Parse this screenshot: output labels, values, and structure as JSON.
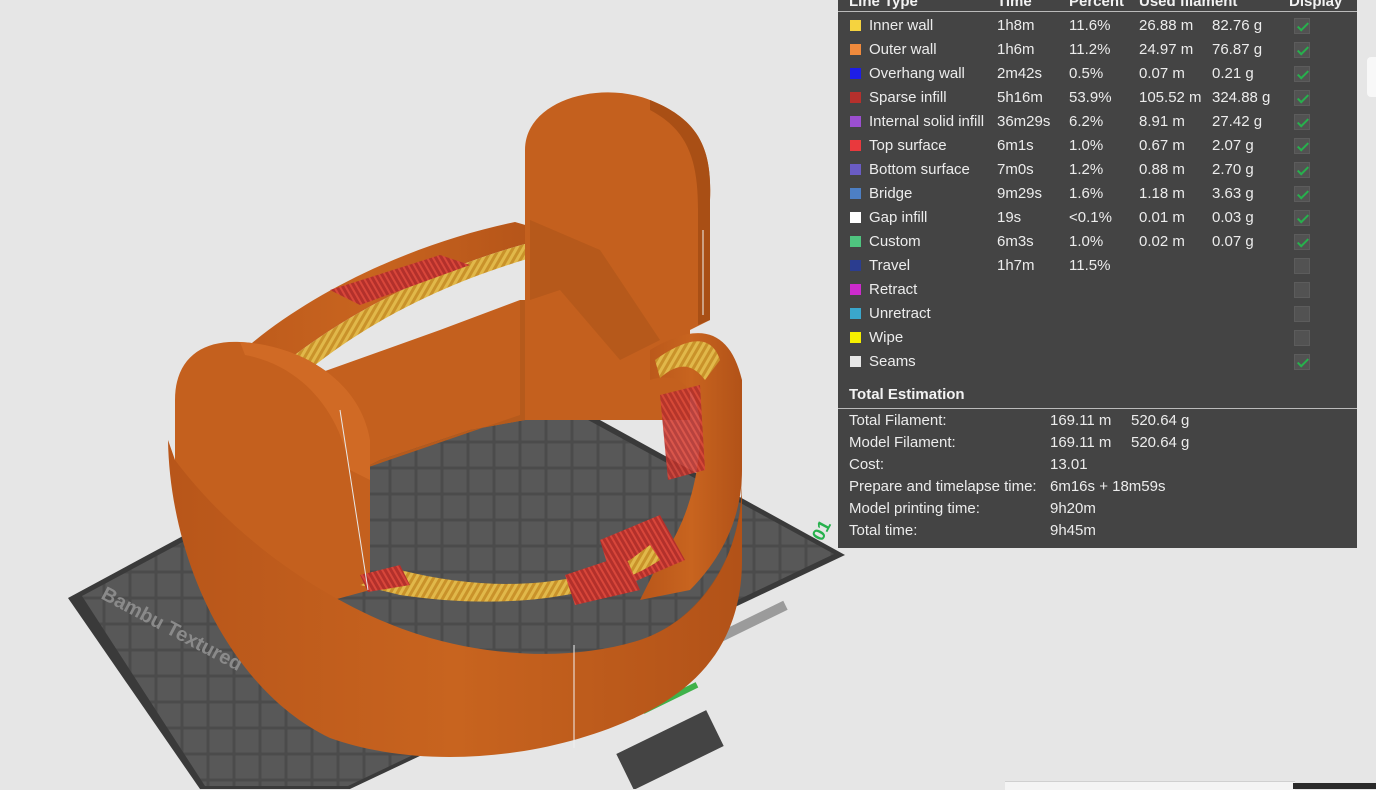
{
  "legend": {
    "headers": {
      "line_type": "Line Type",
      "time": "Time",
      "percent": "Percent",
      "used_filament": "Used filament",
      "display": "Display"
    },
    "rows": [
      {
        "name": "Inner wall",
        "color": "#f5d33f",
        "time": "1h8m",
        "percent": "11.6%",
        "length": "26.88 m",
        "weight": "82.76 g",
        "display": true
      },
      {
        "name": "Outer wall",
        "color": "#f08a3c",
        "time": "1h6m",
        "percent": "11.2%",
        "length": "24.97 m",
        "weight": "76.87 g",
        "display": true
      },
      {
        "name": "Overhang wall",
        "color": "#1d1de6",
        "time": "2m42s",
        "percent": "0.5%",
        "length": "0.07 m",
        "weight": "0.21 g",
        "display": true
      },
      {
        "name": "Sparse infill",
        "color": "#b5302c",
        "time": "5h16m",
        "percent": "53.9%",
        "length": "105.52 m",
        "weight": "324.88 g",
        "display": true
      },
      {
        "name": "Internal solid infill",
        "color": "#9b4fd0",
        "time": "36m29s",
        "percent": "6.2%",
        "length": "8.91 m",
        "weight": "27.42 g",
        "display": true
      },
      {
        "name": "Top surface",
        "color": "#e9393d",
        "time": "6m1s",
        "percent": "1.0%",
        "length": "0.67 m",
        "weight": "2.07 g",
        "display": true
      },
      {
        "name": "Bottom surface",
        "color": "#6a5cc4",
        "time": "7m0s",
        "percent": "1.2%",
        "length": "0.88 m",
        "weight": "2.70 g",
        "display": true
      },
      {
        "name": "Bridge",
        "color": "#4d7fc4",
        "time": "9m29s",
        "percent": "1.6%",
        "length": "1.18 m",
        "weight": "3.63 g",
        "display": true
      },
      {
        "name": "Gap infill",
        "color": "#ffffff",
        "time": "19s",
        "percent": "<0.1%",
        "length": "0.01 m",
        "weight": "0.03 g",
        "display": true
      },
      {
        "name": "Custom",
        "color": "#4fc47f",
        "time": "6m3s",
        "percent": "1.0%",
        "length": "0.02 m",
        "weight": "0.07 g",
        "display": true
      },
      {
        "name": "Travel",
        "color": "#2b3d8f",
        "time": "1h7m",
        "percent": "11.5%",
        "length": "",
        "weight": "",
        "display": false
      },
      {
        "name": "Retract",
        "color": "#cc2bcc",
        "time": "",
        "percent": "",
        "length": "",
        "weight": "",
        "display": false
      },
      {
        "name": "Unretract",
        "color": "#3aa7cc",
        "time": "",
        "percent": "",
        "length": "",
        "weight": "",
        "display": false
      },
      {
        "name": "Wipe",
        "color": "#f5ef00",
        "time": "",
        "percent": "",
        "length": "",
        "weight": "",
        "display": false
      },
      {
        "name": "Seams",
        "color": "#e6e6e6",
        "time": "",
        "percent": "",
        "length": "",
        "weight": "",
        "display": true
      }
    ]
  },
  "total": {
    "title": "Total Estimation",
    "rows": [
      {
        "label": "Total Filament:",
        "value": "169.11 m",
        "value2": "520.64 g"
      },
      {
        "label": "Model Filament:",
        "value": "169.11 m",
        "value2": "520.64 g"
      },
      {
        "label": "Cost:",
        "value": "13.01",
        "value2": ""
      },
      {
        "label": "Prepare and timelapse time:",
        "value": "6m16s + 18m59s",
        "value2": ""
      },
      {
        "label": "Model printing time:",
        "value": "9h20m",
        "value2": ""
      },
      {
        "label": "Total time:",
        "value": "9h45m",
        "value2": ""
      }
    ]
  },
  "plate": {
    "brand_text": "Bambu Textured",
    "plate_number": "01"
  },
  "colors": {
    "model_orange": "#c4601e",
    "plate_dark": "#4a4a4a",
    "panel_bg": "#444444",
    "check_green": "#27b14d"
  }
}
